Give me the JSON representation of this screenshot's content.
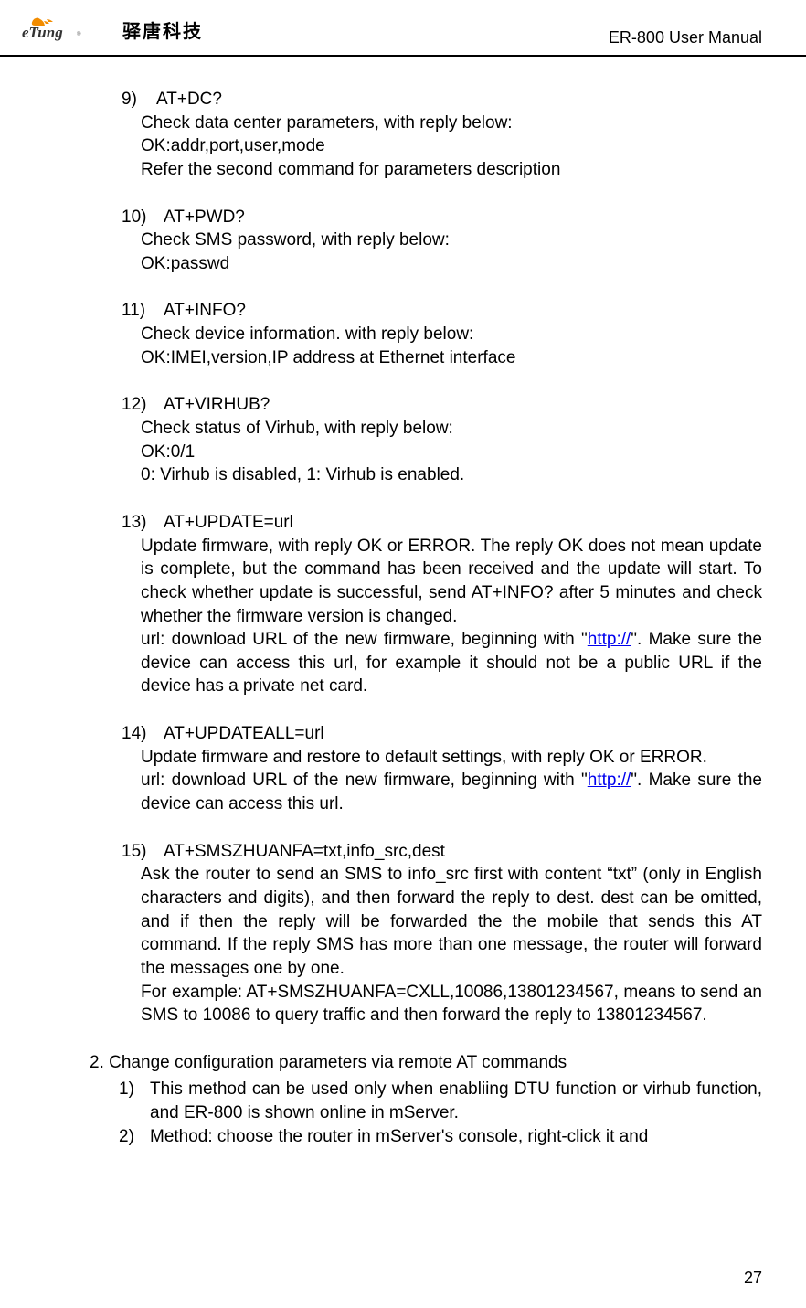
{
  "header": {
    "logo_cjk": "驿唐科技",
    "doc_title": "ER-800 User Manual"
  },
  "items": [
    {
      "num": "9)",
      "title": "AT+DC?",
      "lines": [
        "Check data center parameters, with reply below:",
        "OK:addr,port,user,mode",
        "Refer the second command for parameters description"
      ]
    },
    {
      "num": "10)",
      "title": "AT+PWD?",
      "lines": [
        "Check SMS password, with reply below:",
        "OK:passwd"
      ]
    },
    {
      "num": "11)",
      "title": "AT+INFO?",
      "lines": [
        "Check device information. with reply below:",
        "OK:IMEI,version,IP address at Ethernet interface"
      ]
    },
    {
      "num": "12)",
      "title": "AT+VIRHUB?",
      "lines": [
        "Check status of Virhub, with reply below:",
        "OK:0/1",
        "0: Virhub is disabled, 1: Virhub is enabled."
      ]
    },
    {
      "num": "13)",
      "title": "AT+UPDATE=url",
      "lines": [
        "Update firmware, with reply OK or ERROR. The reply OK does not mean update is complete, but the command has been received and the update will start. To check whether update is successful, send AT+INFO? after 5 minutes and check whether the firmware version is changed."
      ],
      "link_line_prefix": "url: download URL of the new firmware, beginning with \"",
      "link_text": "http://",
      "link_line_suffix": "\". Make sure the device can access this url, for example it should not be a public URL if the device has a private net card."
    },
    {
      "num": "14)",
      "title": "AT+UPDATEALL=url",
      "lines": [
        "Update firmware and restore to default settings, with reply OK or ERROR."
      ],
      "link_line_prefix": "url: download URL of the new firmware, beginning with \"",
      "link_text": "http://",
      "link_line_suffix": "\". Make sure the device can access this url."
    },
    {
      "num": "15)",
      "title": "AT+SMSZHUANFA=txt,info_src,dest",
      "lines": [
        "Ask the router to send an SMS to info_src first with content “txt” (only in English characters and digits), and then forward the reply to dest. dest can be omitted, and if then the reply will be forwarded the the mobile that sends this AT command. If the reply SMS has more than one message, the router will forward the messages one by one.",
        "For example: AT+SMSZHUANFA=CXLL,10086,13801234567, means to send an SMS to 10086 to query traffic and then forward the reply to 13801234567."
      ]
    }
  ],
  "section2": {
    "heading_num": "2.",
    "heading": "Change configuration parameters via remote AT commands",
    "subs": [
      {
        "num": "1)",
        "text": "This method can be used only when enabliing DTU function or virhub function, and ER-800 is shown online in mServer."
      },
      {
        "num": "2)",
        "text": "Method: choose the router in mServer's console, right-click it and"
      }
    ]
  },
  "page_number": "27"
}
